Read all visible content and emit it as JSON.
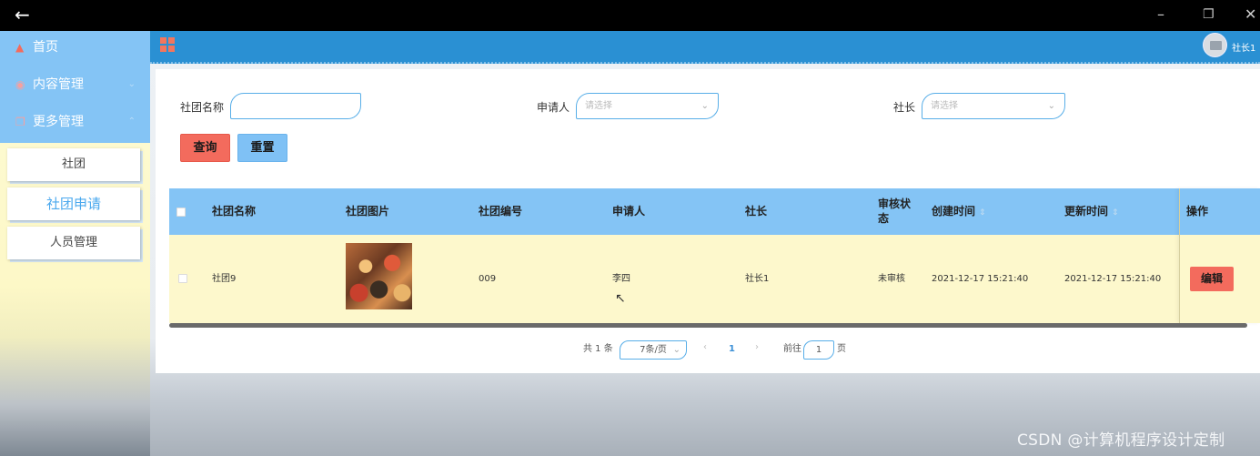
{
  "window": {
    "back_icon": "arrow-left-icon",
    "minimize_icon": "minimize-icon",
    "restore_icon": "restore-icon",
    "close_icon": "close-icon"
  },
  "sidebar": {
    "items": [
      {
        "label": "首页",
        "icon": "home-icon"
      },
      {
        "label": "内容管理",
        "icon": "content-icon",
        "arrow": "chevron-down-icon"
      },
      {
        "label": "更多管理",
        "icon": "more-icon",
        "arrow": "chevron-up-icon"
      }
    ],
    "subitems": [
      {
        "label": "社团"
      },
      {
        "label": "社团申请",
        "active": true
      },
      {
        "label": "人员管理"
      }
    ]
  },
  "topbar": {
    "menu_icon": "grid-icon",
    "avatar_icon": "avatar-icon",
    "username": "社长1"
  },
  "search": {
    "club_name_label": "社团名称",
    "club_name_value": "",
    "applicant_label": "申请人",
    "applicant_placeholder": "请选择",
    "president_label": "社长",
    "president_placeholder": "请选择",
    "query_button": "查询",
    "reset_button": "重置"
  },
  "table": {
    "columns": [
      "社团名称",
      "社团图片",
      "社团编号",
      "申请人",
      "社长",
      "审核状",
      "态",
      "创建时间",
      "更新时间",
      "操作"
    ],
    "rows": [
      {
        "club_name": "社团9",
        "club_number": "009",
        "applicant": "李四",
        "president": "社长1",
        "status": "未审核",
        "created": "2021-12-17 15:21:40",
        "updated": "2021-12-17 15:21:40",
        "edit_label": "编辑"
      }
    ]
  },
  "pagination": {
    "total": "共 1 条",
    "page_size": "7条/页",
    "current_page": "1",
    "goto_prefix": "前往",
    "goto_value": "1",
    "goto_suffix": "页"
  },
  "watermark": "CSDN @计算机程序设计定制",
  "colors": {
    "primary": "#2a90d3",
    "light_blue": "#84c4f5",
    "accent_red": "#f36b5d",
    "row_yellow": "#fdf8cc"
  }
}
